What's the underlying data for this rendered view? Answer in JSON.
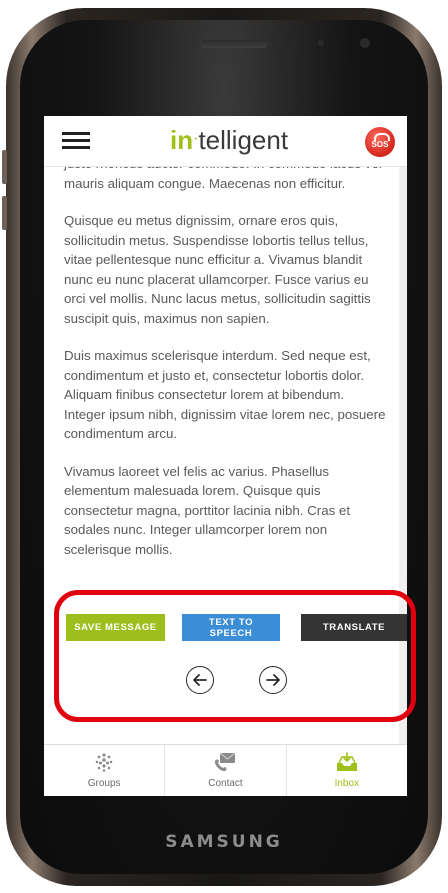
{
  "app": {
    "logo_prefix": "in",
    "logo_dot": "·",
    "logo_suffix": "telligent",
    "sos_label": "SOS"
  },
  "device": {
    "brand": "SAMSUNG"
  },
  "message": {
    "paragraphs": [
      "justo rhoncus auctor commodo. In commodo lacus vel mauris aliquam congue. Maecenas non efficitur.",
      "Quisque eu metus dignissim, ornare eros quis, sollicitudin metus. Suspendisse lobortis tellus tellus, vitae pellentesque nunc efficitur a. Vivamus blandit nunc eu nunc placerat ullamcorper. Fusce varius eu orci vel mollis. Nunc lacus metus, sollicitudin sagittis suscipit quis, maximus non sapien.",
      "Duis maximus scelerisque interdum. Sed neque est, condimentum et justo et, consectetur lobortis dolor. Aliquam finibus consectetur lorem at bibendum. Integer ipsum nibh, dignissim vitae lorem nec, posuere condimentum arcu.",
      "Vivamus laoreet vel felis ac varius. Phasellus elementum malesuada lorem. Quisque quis consectetur magna, porttitor lacinia nibh. Cras et sodales nunc. Integer ullamcorper lorem non scelerisque mollis."
    ]
  },
  "actions": {
    "save_label": "SAVE MESSAGE",
    "tts_label": "TEXT TO SPEECH",
    "translate_label": "TRANSLATE"
  },
  "tabs": [
    {
      "label": "Groups",
      "icon": "groups-icon"
    },
    {
      "label": "Contact",
      "icon": "contact-icon"
    },
    {
      "label": "Inbox",
      "icon": "inbox-icon",
      "active": true
    }
  ],
  "colors": {
    "brand_green": "#9fbf19",
    "save_button": "#9dbf1e",
    "tts_button": "#3b8dd6",
    "translate_button": "#343434",
    "highlight": "#e00010",
    "sos": "#d3261b"
  }
}
